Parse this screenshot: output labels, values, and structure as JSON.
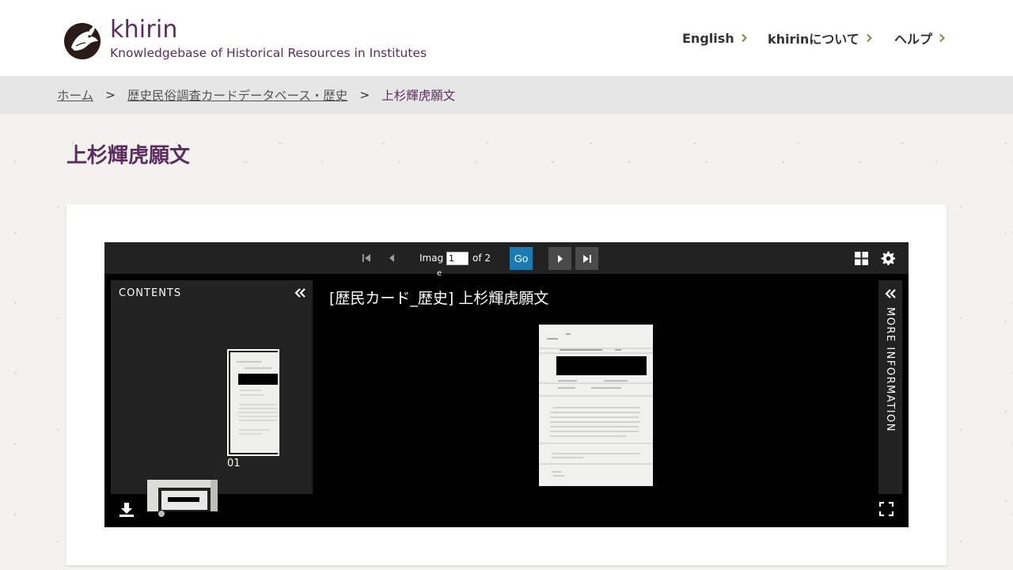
{
  "site": {
    "name": "khirin",
    "tagline": "Knowledgebase of Historical Resources in Institutes",
    "logo_icon": "dragon-logo-icon"
  },
  "nav": [
    {
      "label": "English",
      "icon": "chevron-right-icon"
    },
    {
      "label": "khirinについて",
      "icon": "chevron-right-icon"
    },
    {
      "label": "ヘルプ",
      "icon": "chevron-right-icon"
    }
  ],
  "breadcrumb": {
    "home": "ホーム",
    "separator": ">",
    "collection": "歴史民俗調査カードデータベース・歴史",
    "current": "上杉輝虎願文"
  },
  "page": {
    "title": "上杉輝虎願文"
  },
  "viewer": {
    "pager_label": "Imag",
    "pager_label_wrap": "e",
    "page_value": "1",
    "page_of": "of 2",
    "go_label": "Go",
    "contents_title": "CONTENTS",
    "thumb_label": "01",
    "doc_title": "[歴民カード_歴史] 上杉輝虎願文",
    "more_info_label": "MORE INFORMATION",
    "colors": {
      "accent": "#1c7bb3",
      "brand": "#5b2c5e",
      "panel": "#222222"
    }
  }
}
